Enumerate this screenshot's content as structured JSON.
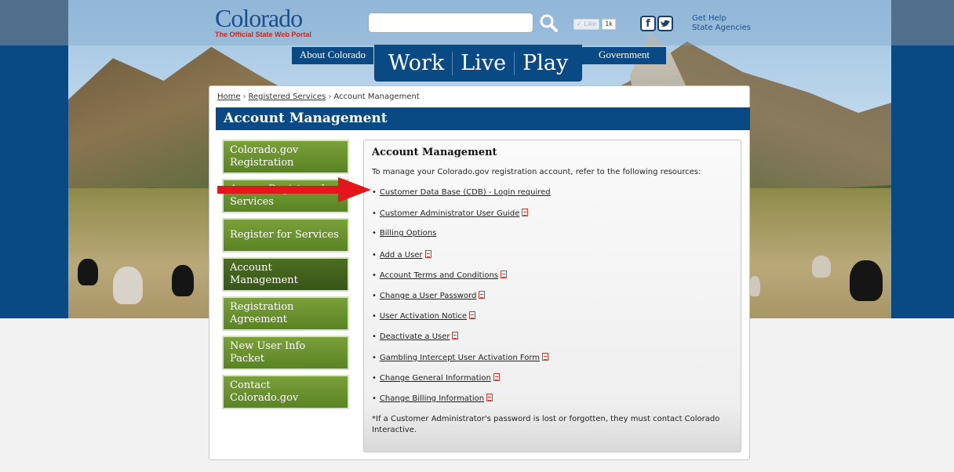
{
  "header": {
    "logo_main": "Colorado",
    "logo_sub": "The Official State Web Portal",
    "search_placeholder": "",
    "search_value": "",
    "like_label": "✓ Like",
    "like_count": "1k",
    "facebook_glyph": "f",
    "twitter_glyph": "🐦",
    "help_links": [
      "Get Help",
      "State Agencies"
    ]
  },
  "nav": {
    "about": "About Colorado",
    "main": [
      "Work",
      "Live",
      "Play"
    ],
    "government": "Government"
  },
  "breadcrumb": {
    "home": "Home",
    "registered": "Registered Services",
    "current": "Account Management",
    "separator": "›"
  },
  "page_title": "Account Management",
  "sidenav": [
    {
      "label": "Colorado.gov Registration",
      "active": false
    },
    {
      "label": "Access Registered Services",
      "active": false
    },
    {
      "label": "Register for Services",
      "active": false
    },
    {
      "label": "Account Management",
      "active": true
    },
    {
      "label": "Registration Agreement",
      "active": false
    },
    {
      "label": "New User Info Packet",
      "active": false
    },
    {
      "label": "Contact Colorado.gov",
      "active": false
    }
  ],
  "content": {
    "heading": "Account Management",
    "intro": "To manage your Colorado.gov registration account, refer to the following resources:",
    "links": [
      {
        "label": "Customer Data Base (CDB) - Login required",
        "pdf": false
      },
      {
        "label": "Customer Administrator User Guide",
        "pdf": true
      },
      {
        "label": "Billing Options",
        "pdf": false
      },
      {
        "label": "Add a User",
        "pdf": true
      },
      {
        "label": "Account Terms and Conditions",
        "pdf": true
      },
      {
        "label": "Change a User Password",
        "pdf": true
      },
      {
        "label": "User Activation Notice",
        "pdf": true
      },
      {
        "label": "Deactivate a User",
        "pdf": true
      },
      {
        "label": "Gambling Intercept User Activation Form",
        "pdf": true
      },
      {
        "label": "Change General Information",
        "pdf": true
      },
      {
        "label": "Change Billing Information",
        "pdf": true
      }
    ],
    "note": "*If a Customer Administrator's password is lost or forgotten, they must contact Colorado Interactive."
  },
  "colors": {
    "brand_blue": "#0a4a84",
    "nav_green": "#5a8323",
    "nav_green_active": "#38551a",
    "arrow_red": "#e3161b",
    "pdf_red": "#d23b2d"
  }
}
